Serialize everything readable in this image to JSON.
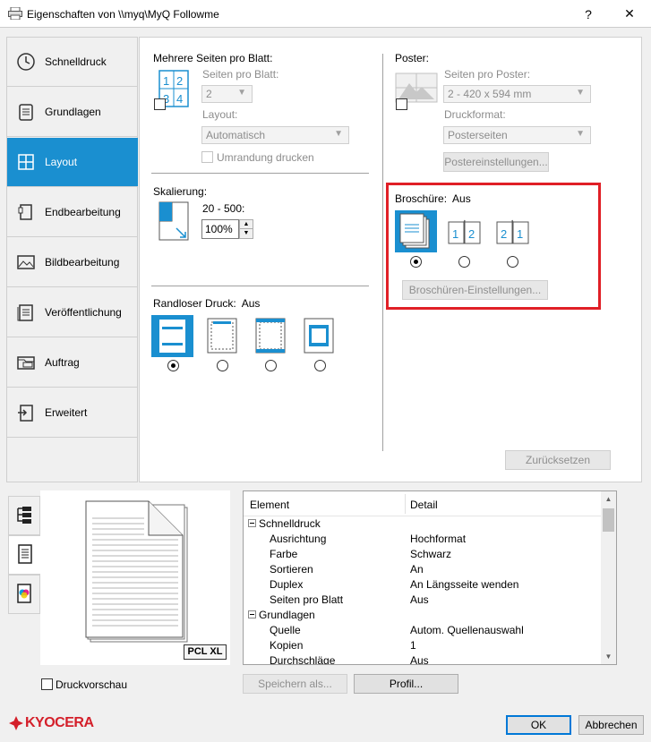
{
  "window": {
    "title": "Eigenschaften von \\\\myq\\MyQ Followme",
    "help": "?",
    "close": "✕"
  },
  "sidebar": {
    "items": [
      {
        "label": "Schnelldruck",
        "icon": "clock-icon"
      },
      {
        "label": "Grundlagen",
        "icon": "document-icon"
      },
      {
        "label": "Layout",
        "icon": "layout-grid-icon",
        "active": true
      },
      {
        "label": "Endbearbeitung",
        "icon": "staple-icon"
      },
      {
        "label": "Bildbearbeitung",
        "icon": "image-icon"
      },
      {
        "label": "Veröffentlichung",
        "icon": "publication-icon"
      },
      {
        "label": "Auftrag",
        "icon": "job-icon"
      },
      {
        "label": "Erweitert",
        "icon": "advanced-icon"
      }
    ]
  },
  "layout": {
    "multi": {
      "title": "Mehrere Seiten pro Blatt:",
      "pages_label": "Seiten pro Blatt:",
      "pages_value": "2",
      "layout_label": "Layout:",
      "layout_value": "Automatisch",
      "border_label": "Umrandung drucken"
    },
    "poster": {
      "title": "Poster:",
      "pages_label": "Seiten pro Poster:",
      "pages_value": "2 - 420 x 594 mm",
      "format_label": "Druckformat:",
      "format_value": "Posterseiten",
      "settings_btn": "Postereinstellungen..."
    },
    "scaling": {
      "title": "Skalierung:",
      "range": "20 - 500:",
      "value": "100%"
    },
    "booklet": {
      "title": "Broschüre:",
      "state": "Aus",
      "settings_btn": "Broschüren-Einstellungen...",
      "selected": 0
    },
    "borderless": {
      "title": "Randloser Druck:",
      "state": "Aus",
      "selected": 0
    },
    "reset_btn": "Zurücksetzen"
  },
  "preview": {
    "badge": "PCL XL"
  },
  "summary": {
    "headers": {
      "element": "Element",
      "detail": "Detail"
    },
    "rows": [
      {
        "group": true,
        "element": "Schnelldruck"
      },
      {
        "element": "Ausrichtung",
        "detail": "Hochformat"
      },
      {
        "element": "Farbe",
        "detail": "Schwarz"
      },
      {
        "element": "Sortieren",
        "detail": "An"
      },
      {
        "element": "Duplex",
        "detail": "An Längsseite wenden"
      },
      {
        "element": "Seiten pro Blatt",
        "detail": "Aus"
      },
      {
        "group": true,
        "element": "Grundlagen"
      },
      {
        "element": "Quelle",
        "detail": "Autom. Quellenauswahl"
      },
      {
        "element": "Kopien",
        "detail": "1"
      },
      {
        "element": "Durchschläge",
        "detail": "Aus"
      }
    ]
  },
  "bottom": {
    "preview_check": "Druckvorschau",
    "save_btn": "Speichern als...",
    "profile_btn": "Profil...",
    "brand": "KYOCERA",
    "ok_btn": "OK",
    "cancel_btn": "Abbrechen"
  },
  "colors": {
    "accent": "#1a8fd0",
    "highlight": "#e01f26",
    "brand": "#d41f2a"
  }
}
